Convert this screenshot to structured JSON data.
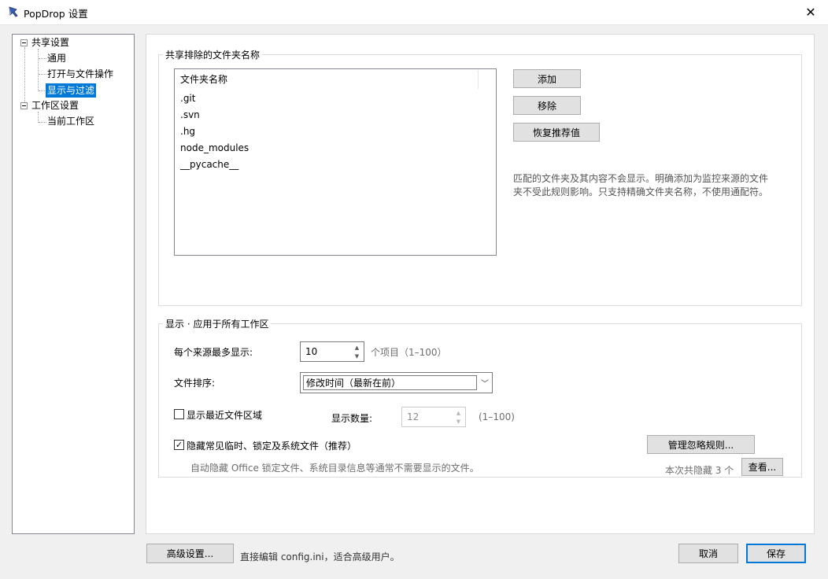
{
  "window": {
    "title": "PopDrop 设置",
    "close_glyph": "✕"
  },
  "tree": {
    "shared": "共享设置",
    "general": "通用",
    "open_ops": "打开与文件操作",
    "display_filter": "显示与过滤",
    "workspace": "工作区设置",
    "current_workspace": "当前工作区",
    "selected": "显示与过滤"
  },
  "excluded": {
    "group_title": "共享排除的文件夹名称",
    "column_header": "文件夹名称",
    "items": [
      ".git",
      ".svn",
      ".hg",
      "node_modules",
      "__pycache__"
    ],
    "add": "添加",
    "remove": "移除",
    "restore": "恢复推荐值",
    "desc_line1": "匹配的文件夹及其内容不会显示。明确添加为监控来源的文件",
    "desc_line2": "夹不受此规则影响。只支持精确文件夹名称，不使用通配符。"
  },
  "display": {
    "group_title": "显示 · 应用于所有工作区",
    "max_label": "每个来源最多显示:",
    "max_value": "10",
    "max_unit": "个项目（1–100）",
    "sort_label": "文件排序:",
    "sort_value": "修改时间（最新在前）",
    "recent_label": "显示最近文件区域",
    "recent_checked": false,
    "count_label": "显示数量:",
    "count_value": "12",
    "count_range": "(1–100)",
    "hide_label": "隐藏常见临时、锁定及系统文件（推荐）",
    "hide_checked": true,
    "manage": "管理忽略规则...",
    "hide_desc": "自动隐藏 Office 锁定文件、系统目录信息等通常不需要显示的文件。",
    "hidden_count": "本次共隐藏 3 个",
    "view": "查看..."
  },
  "footer": {
    "advanced": "高级设置...",
    "advanced_hint": "直接编辑 config.ini，适合高级用户。",
    "cancel": "取消",
    "save": "保存"
  },
  "colors": {
    "selection": "#0078d7",
    "default_border": "#0078d7"
  }
}
